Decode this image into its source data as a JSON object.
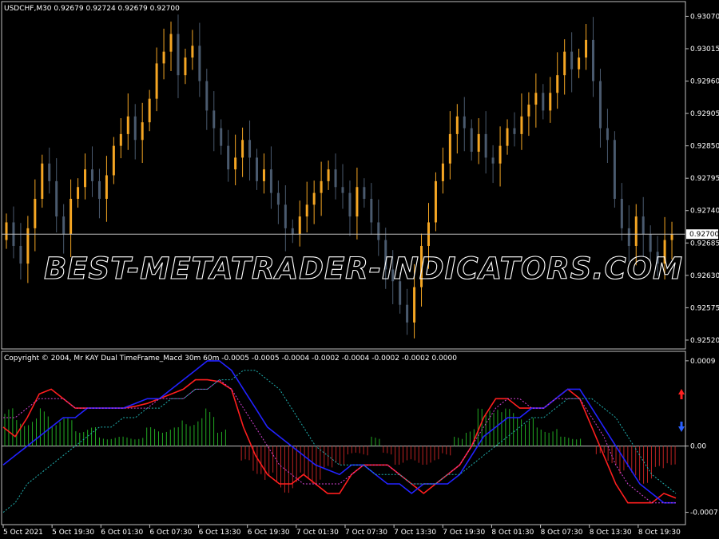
{
  "header": {
    "symbol_line": "USDCHF,M30  0.92679 0.92724 0.92679 0.92700",
    "indicator_line": "Copyright © 2004, Mr KAY Dual TimeFrame_Macd 30m 60m  -0.0005 -0.0005 -0.0004 -0.0002 -0.0004 -0.0002 -0.0002 0.0000"
  },
  "watermark": "BEST-METATRADER-INDICATORS.COM",
  "colors": {
    "background": "#000000",
    "frame": "#c0c0c0",
    "bull_candle": "#f5a623",
    "bear_candle": "#4a5a6e",
    "macd_fast": "#ff1e1e",
    "macd_slow": "#2222ff",
    "signal_fast": "#d040d0",
    "signal_slow": "#20b0b0",
    "hist_up": "#22aa22",
    "hist_down": "#bb2222",
    "arrow_up": "#ff2020",
    "arrow_down": "#2a60ff"
  },
  "chart_data": [
    {
      "type": "candlestick",
      "title": "USDCHF,M30",
      "price_axis": {
        "ticks": [
          "0.93070",
          "0.93015",
          "0.92960",
          "0.92905",
          "0.92850",
          "0.92795",
          "0.92740",
          "0.92685",
          "0.92630",
          "0.92575",
          "0.92520"
        ],
        "tick_values": [
          0.9307,
          0.93015,
          0.9296,
          0.92905,
          0.9285,
          0.92795,
          0.9274,
          0.92685,
          0.9263,
          0.92575,
          0.9252
        ],
        "ylim": [
          0.92505,
          0.93095
        ]
      },
      "current_price": "0.92700",
      "current_price_value": 0.927,
      "closes": [
        0.9272,
        0.9268,
        0.9265,
        0.9271,
        0.9276,
        0.9282,
        0.9279,
        0.9273,
        0.927,
        0.9276,
        0.9278,
        0.9281,
        0.9279,
        0.9276,
        0.928,
        0.9285,
        0.9287,
        0.929,
        0.9286,
        0.9289,
        0.9293,
        0.9299,
        0.9301,
        0.9304,
        0.9297,
        0.93,
        0.9302,
        0.9296,
        0.9291,
        0.9288,
        0.9285,
        0.9281,
        0.9283,
        0.9286,
        0.9283,
        0.9279,
        0.9281,
        0.9277,
        0.9275,
        0.9271,
        0.927,
        0.9273,
        0.9275,
        0.9277,
        0.9279,
        0.9281,
        0.9278,
        0.9277,
        0.9273,
        0.9278,
        0.9276,
        0.9272,
        0.9269,
        0.9264,
        0.9262,
        0.9258,
        0.9255,
        0.9261,
        0.9268,
        0.9272,
        0.9279,
        0.9282,
        0.9287,
        0.929,
        0.9288,
        0.9284,
        0.9287,
        0.9283,
        0.9282,
        0.9285,
        0.9288,
        0.9287,
        0.929,
        0.9292,
        0.9294,
        0.9291,
        0.9294,
        0.9297,
        0.9301,
        0.9298,
        0.93,
        0.9303,
        0.9296,
        0.9288,
        0.9286,
        0.9276,
        0.9271,
        0.9268,
        0.9273,
        0.927,
        0.9267,
        0.9265,
        0.9269,
        0.927
      ],
      "time_axis": {
        "ticks": [
          "5 Oct 2021",
          "5 Oct 19:30",
          "6 Oct 01:30",
          "6 Oct 07:30",
          "6 Oct 13:30",
          "6 Oct 19:30",
          "7 Oct 01:30",
          "7 Oct 07:30",
          "7 Oct 13:30",
          "7 Oct 19:30",
          "8 Oct 01:30",
          "8 Oct 07:30",
          "8 Oct 13:30",
          "8 Oct 19:30"
        ]
      },
      "grid": false
    },
    {
      "type": "line+histogram",
      "title": "Mr KAY Dual TimeFrame_Macd 30m 60m",
      "value_axis": {
        "ticks": [
          "0.0009",
          "0.00",
          "-0.0007"
        ],
        "tick_values": [
          0.0009,
          0.0,
          -0.0007
        ],
        "ylim": [
          -0.00083,
          0.001
        ]
      },
      "zero_line": 0,
      "series": [
        {
          "key": "macd_fast",
          "values": [
            0.0002,
            0.0001,
            0.0003,
            0.00055,
            0.0006,
            0.0005,
            0.0004,
            0.0004,
            0.0004,
            0.0004,
            0.0004,
            0.00042,
            0.00045,
            0.0005,
            0.00055,
            0.0006,
            0.0007,
            0.0007,
            0.00068,
            0.0006,
            0.0002,
            -0.0001,
            -0.0003,
            -0.0004,
            -0.0004,
            -0.0003,
            -0.0004,
            -0.0005,
            -0.0005,
            -0.0003,
            -0.0002,
            -0.0002,
            -0.0002,
            -0.0003,
            -0.0004,
            -0.0005,
            -0.0004,
            -0.0003,
            -0.0002,
            0.0,
            0.0003,
            0.0005,
            0.0005,
            0.0004,
            0.0004,
            0.0004,
            0.0005,
            0.0006,
            0.0005,
            0.0002,
            -0.0001,
            -0.0004,
            -0.0006,
            -0.0006,
            -0.0006,
            -0.0005,
            -0.00055
          ],
          "format": "line"
        },
        {
          "key": "macd_slow",
          "values": [
            -0.0002,
            -0.0001,
            0.0,
            0.0001,
            0.0002,
            0.0003,
            0.0003,
            0.0004,
            0.0004,
            0.0004,
            0.0004,
            0.00045,
            0.0005,
            0.0005,
            0.0006,
            0.0007,
            0.0008,
            0.0009,
            0.0009,
            0.0008,
            0.0006,
            0.0004,
            0.0002,
            0.0001,
            0.0,
            -0.0001,
            -0.0002,
            -0.00025,
            -0.0003,
            -0.0002,
            -0.0002,
            -0.0003,
            -0.0004,
            -0.0004,
            -0.0005,
            -0.0004,
            -0.0004,
            -0.0004,
            -0.0003,
            -0.0001,
            0.0001,
            0.0002,
            0.0003,
            0.0003,
            0.0004,
            0.0004,
            0.0005,
            0.0006,
            0.0006,
            0.0004,
            0.0002,
            0.0,
            -0.0002,
            -0.0004,
            -0.0005,
            -0.0006,
            -0.0006
          ],
          "format": "line"
        },
        {
          "key": "signal_fast",
          "values": [
            0.0003,
            0.0003,
            0.0004,
            0.0005,
            0.0005,
            0.0005,
            0.0004,
            0.0004,
            0.0004,
            0.0004,
            0.0004,
            0.0004,
            0.0004,
            0.0005,
            0.0005,
            0.0005,
            0.0006,
            0.0006,
            0.0007,
            0.0006,
            0.0004,
            0.0002,
            0.0,
            -0.0002,
            -0.0003,
            -0.0004,
            -0.0004,
            -0.0004,
            -0.0004,
            -0.0003,
            -0.0002,
            -0.0002,
            -0.0002,
            -0.0003,
            -0.0004,
            -0.0004,
            -0.0004,
            -0.0003,
            -0.0002,
            0.0,
            0.0002,
            0.0004,
            0.0005,
            0.0005,
            0.0004,
            0.0004,
            0.0005,
            0.0005,
            0.0005,
            0.0003,
            0.0001,
            -0.0002,
            -0.0004,
            -0.0005,
            -0.0006,
            -0.0006,
            -0.0006
          ],
          "format": "dotted"
        },
        {
          "key": "signal_slow",
          "values": [
            -0.0007,
            -0.0006,
            -0.0004,
            -0.0003,
            -0.0002,
            -0.0001,
            0.0,
            0.0001,
            0.0002,
            0.0002,
            0.0003,
            0.0003,
            0.0004,
            0.0004,
            0.0005,
            0.0005,
            0.0006,
            0.0006,
            0.0007,
            0.0007,
            0.0008,
            0.0008,
            0.0007,
            0.0006,
            0.0004,
            0.0002,
            0.0,
            -0.0001,
            -0.0002,
            -0.0002,
            -0.0002,
            -0.0003,
            -0.0003,
            -0.0003,
            -0.0004,
            -0.0004,
            -0.0004,
            -0.0003,
            -0.0003,
            -0.0002,
            -0.0001,
            0.0,
            0.0001,
            0.0002,
            0.0003,
            0.0003,
            0.0004,
            0.0005,
            0.0005,
            0.0005,
            0.0004,
            0.0003,
            0.0001,
            -0.0001,
            -0.0003,
            -0.0004,
            -0.0005
          ],
          "format": "dotted"
        }
      ],
      "histogram": [
        0.0004,
        0.0003,
        0.0003,
        0.0004,
        0.0003,
        0.0003,
        0.0002,
        0.0002,
        0.0001,
        0.0001,
        0.0001,
        0.0001,
        0.0002,
        0.0002,
        0.0002,
        0.0003,
        0.0003,
        0.0004,
        0.0002,
        0.0,
        -0.0002,
        -0.0003,
        -0.0004,
        -0.0005,
        -0.0005,
        -0.0004,
        -0.0004,
        -0.0003,
        -0.0002,
        -0.0001,
        -0.0001,
        0.0001,
        -0.0001,
        -0.0002,
        -0.0002,
        -0.0002,
        -0.0002,
        -0.0001,
        0.0001,
        0.0002,
        0.0004,
        0.0005,
        0.0004,
        0.0004,
        0.0003,
        0.0002,
        0.0002,
        0.0001,
        0.0001,
        0.0,
        -0.0001,
        -0.0002,
        -0.0003,
        -0.0004,
        -0.0004,
        -0.0003,
        -0.0002
      ],
      "arrows": [
        "up",
        "down"
      ]
    }
  ]
}
